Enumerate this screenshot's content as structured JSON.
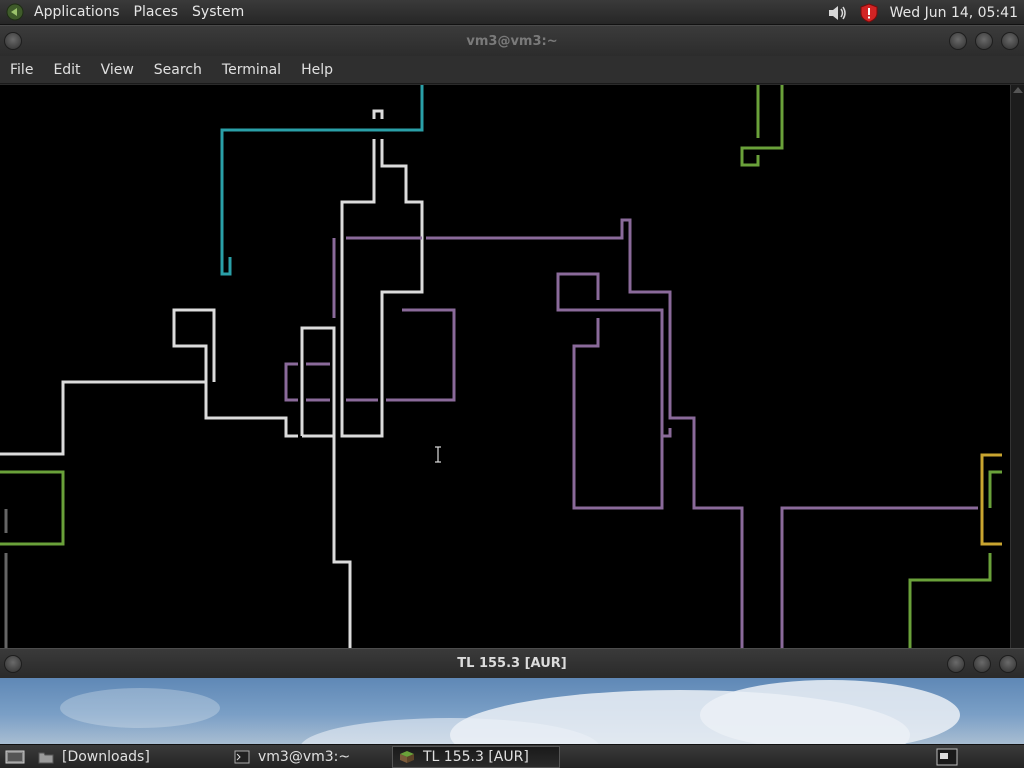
{
  "top_panel": {
    "menus": [
      "Applications",
      "Places",
      "System"
    ],
    "clock": "Wed Jun 14, 05:41",
    "icons": [
      "gnome-foot-icon",
      "volume-icon",
      "shield-alert-icon"
    ]
  },
  "terminal_window": {
    "title": "vm3@vm3:~",
    "menu": [
      "File",
      "Edit",
      "View",
      "Search",
      "Terminal",
      "Help"
    ],
    "pipe_colors": {
      "white": "#dcdcdc",
      "cyan": "#2aa0a8",
      "green": "#6aa13a",
      "purple": "#8a6a9a",
      "yellow": "#c9a530",
      "gray": "#666666"
    }
  },
  "second_window": {
    "title": "TL 155.3 [AUR]"
  },
  "taskbar": {
    "items": [
      {
        "label": "[Downloads]",
        "icon": "folder-icon",
        "active": false
      },
      {
        "label": "vm3@vm3:~",
        "icon": "terminal-icon",
        "active": false
      },
      {
        "label": "TL 155.3 [AUR]",
        "icon": "minecraft-block-icon",
        "active": true
      }
    ]
  }
}
